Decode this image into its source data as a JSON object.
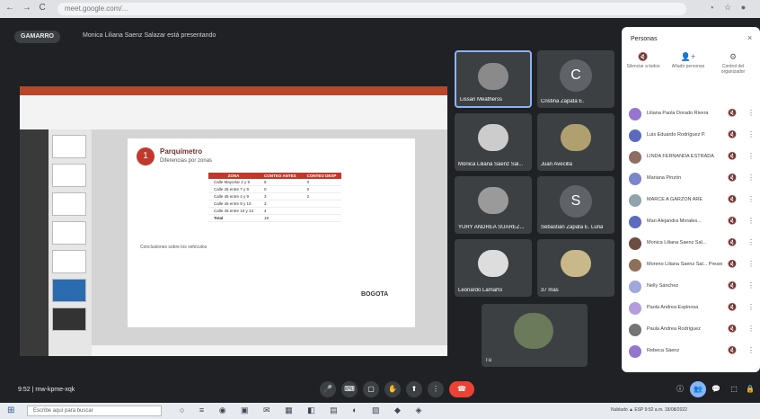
{
  "browser": {
    "nav": "← → C",
    "url": "meet.google.com/...",
    "extensions": "⋆ ☆ ●"
  },
  "meet": {
    "presenting_pill": "GAMARRO",
    "presenting_text": "Monica Liliana Saenz Salazar está presentando",
    "time_label": "9:52 | rnw-kpme-xqk"
  },
  "ppt": {
    "title_bar": "",
    "slide_number": "1",
    "slide_title": "Parquímetro",
    "slide_subtitle": "Diferencias por zonas",
    "table_headers": [
      "ZONA",
      "CONTEO ANTES",
      "CONTEO DESP"
    ],
    "table_rows": [
      [
        "Calle Mayorlar 2 y 9",
        "8",
        "0"
      ],
      [
        "Calle 45 entre 7 y 9",
        "0",
        "0"
      ],
      [
        "Calle 45 entre 4 y 9",
        "3",
        "2"
      ],
      [
        "Calle 45 entre 9 y 10",
        "3",
        ""
      ],
      [
        "Calle 45 entre 10 y 13",
        "4",
        ""
      ],
      [
        "Total",
        "18",
        ""
      ]
    ],
    "section_heading": "Conclusiones sobre los vehículos",
    "logo_text": "BOGOTA"
  },
  "tiles": [
    {
      "name": "Lissan Meatherss",
      "type": "photo"
    },
    {
      "name": "Cristina Zapata E.",
      "type": "letter",
      "letter": "C",
      "color": "#5f6368"
    },
    {
      "name": "Monica Liliana Saenz Sal...",
      "type": "photo"
    },
    {
      "name": "Juan Avecilla",
      "type": "photo"
    },
    {
      "name": "YURY ANDREA SUAREZ...",
      "type": "photo"
    },
    {
      "name": "Sebastián Zapata E. Luna",
      "type": "letter",
      "letter": "S",
      "color": "#5f6368"
    },
    {
      "name": "Leonardo Lamarto",
      "type": "photo"
    },
    {
      "name": "37 más",
      "type": "photo"
    },
    {
      "name": "Tú",
      "type": "photo"
    }
  ],
  "controls": {
    "buttons": [
      "🎤",
      "⌨",
      "▢",
      "✋",
      "⬆",
      "⋮"
    ],
    "end": "☎",
    "right": [
      "ⓘ",
      "👥",
      "💬",
      "⬚",
      "🔒"
    ]
  },
  "panel": {
    "title": "Personas",
    "close": "×",
    "actions": [
      {
        "icon": "🔇",
        "label": "Silenciar a todos"
      },
      {
        "icon": "👤+",
        "label": "Añadir personas"
      },
      {
        "icon": "⚙",
        "label": "Control del organizador"
      }
    ],
    "people": [
      {
        "name": "Liliana Paola Dorado Rivera",
        "color": "#9575cd"
      },
      {
        "name": "Luis Eduardo Rodríguez P.",
        "color": "#5c6bc0"
      },
      {
        "name": "LINDA FERNANDA ESTRADA",
        "color": "#8d6e63"
      },
      {
        "name": "Mariana Pinzón",
        "color": "#7986cb"
      },
      {
        "name": "MARCE A GARZÓN ARE",
        "color": "#90a4ae"
      },
      {
        "name": "Mari Alejandra Morales...",
        "color": "#5c6bc0"
      },
      {
        "name": "Monica Liliana Saenz Sal...",
        "color": "#6d4c41"
      },
      {
        "name": "Moreno Liliana Saenz Sal... Presentando",
        "color": "#8e6f5a"
      },
      {
        "name": "Nelly Sánchez",
        "color": "#9fa8da"
      },
      {
        "name": "Paola Andrea Espinosa",
        "color": "#b39ddb"
      },
      {
        "name": "Paula Andrea Rodríguez",
        "color": "#757575"
      },
      {
        "name": "Rebeca Sáenz",
        "color": "#9575cd"
      }
    ]
  },
  "taskbar": {
    "search": "Escribe aquí para buscar",
    "icons": "○ ≡ ◉ ▣ ✉ ▦ ◧ ▤ ◐ ▧ ◆ ◈",
    "tray": "Nublado  ▲  ESP  9:52 a.m.  18/08/2022"
  }
}
